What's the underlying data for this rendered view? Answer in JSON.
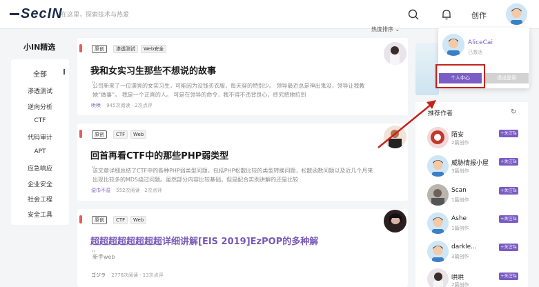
{
  "header": {
    "logo_text": "SecIN",
    "search_placeholder": "在这里，探索技术与热爱",
    "create_label": "创作"
  },
  "sidebar": {
    "title": "小IN精选",
    "items": [
      {
        "label": "全部",
        "active": true
      },
      {
        "label": "渗透测试"
      },
      {
        "label": "逆向分析"
      },
      {
        "label": "CTF"
      },
      {
        "label": "代码审计"
      },
      {
        "label": "APT"
      },
      {
        "label": "应急响应"
      },
      {
        "label": "企业安全"
      },
      {
        "label": "社会工程"
      },
      {
        "label": "安全工具"
      }
    ]
  },
  "feed": {
    "sort_label": "热度排序",
    "articles": [
      {
        "tags": [
          "原创",
          "渗透测试",
          "Web安全"
        ],
        "title": "我和女实习生那些不想说的故事",
        "excerpt": "公司新来了一位漂亮的女实习生，可能因为没钱买衣服，每天穿的特别少。 领导最近总是神出鬼没，领导让我教她“做事”。 我是一个正直的人。 可是在领导的命令，我不得不违背良心，终究把她拉到",
        "author": "哄哄",
        "views": "945次阅读",
        "comments": "2次点评"
      },
      {
        "tags": [
          "原创",
          "CTF",
          "Web"
        ],
        "title": "回首再看CTF中的那些PHP弱类型",
        "excerpt": "该文章详细总结了CTF中的各种PHP弱类型问题，包括PHP松散比较的类型转换问题，松散函数问题以及近几个月来出现比较多的MD5绕过问题。虽然部分内容比较基础，但是配合实例讲解的还是比较",
        "author": "湿巾不湿",
        "views": "552次阅读",
        "comments": "2次点评"
      },
      {
        "tags": [
          "原创",
          "CTF",
          "Web"
        ],
        "title": "超超超超超超超超详细讲解[EIS 2019]EzPOP的多种解",
        "excerpt": "新手web",
        "author": "ゴジラ",
        "views": "2778次阅读",
        "comments": "13次点评"
      }
    ]
  },
  "recommend": {
    "title": "推荐作者",
    "follow_label": "+关注Ta",
    "authors": [
      {
        "name": "陌安",
        "count": "2篇创作"
      },
      {
        "name": "威胁情报小屋",
        "count": "3篇创作"
      },
      {
        "name": "Scan",
        "count": "1篇创作"
      },
      {
        "name": "Ashe",
        "count": "1篇创作"
      },
      {
        "name": "darkle...",
        "count": "3篇创作"
      },
      {
        "name": "哄哄",
        "count": "2篇创作"
      }
    ]
  },
  "user_menu": {
    "username": "AliceCai",
    "status": "已激活",
    "center_label": "个人中心",
    "logout_label": "退出登录"
  },
  "colors": {
    "accent_purple": "#7b5cc4",
    "highlight_red": "#c9211b",
    "card_accent": "#e85d5d"
  }
}
